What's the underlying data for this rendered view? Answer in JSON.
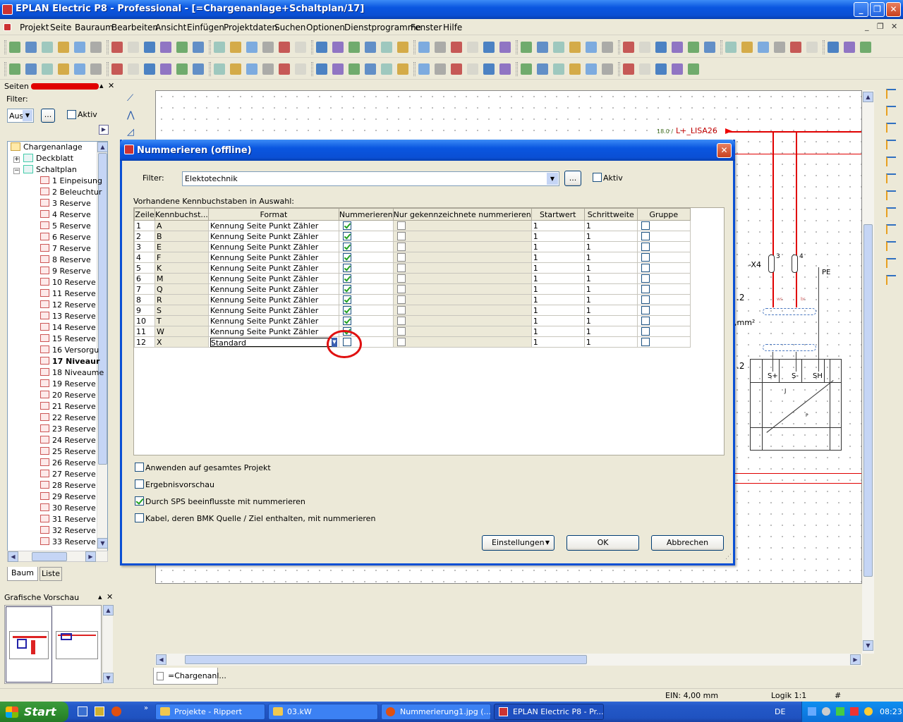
{
  "window": {
    "title": "EPLAN Electric P8 - Professional - [=Chargenanlage+Schaltplan/17]",
    "minimize": "_",
    "maximize": "❐",
    "close": "✕"
  },
  "menu": [
    "Projekt",
    "Seite",
    "Bauraum",
    "Bearbeiten",
    "Ansicht",
    "Einfügen",
    "Projektdaten",
    "Suchen",
    "Optionen",
    "Dienstprogramme",
    "Fenster",
    "Hilfe"
  ],
  "pages_panel": {
    "title": "Seiten -",
    "filter_label": "Filter:",
    "filter_value": "Aus",
    "browse_label": "...",
    "aktiv_label": "Aktiv",
    "tree_root": "Chargenanlage",
    "tree_nodes": [
      "Deckblatt",
      "Schaltplan"
    ],
    "pages": [
      "1 Einpeisung",
      "2 Beleuchtur",
      "3 Reserve",
      "4 Reserve",
      "5 Reserve",
      "6 Reserve",
      "7 Reserve",
      "8 Reserve",
      "9 Reserve",
      "10 Reserve",
      "11 Reserve",
      "12 Reserve",
      "13 Reserve",
      "14 Reserve",
      "15 Reserve",
      "16 Versorgu",
      "17 Niveaur",
      "18 Niveaume",
      "19 Reserve",
      "20 Reserve",
      "21 Reserve",
      "22 Reserve",
      "23 Reserve",
      "24 Reserve",
      "25 Reserve",
      "26 Reserve",
      "27 Reserve",
      "28 Reserve",
      "29 Reserve",
      "30 Reserve",
      "31 Reserve",
      "32 Reserve",
      "33 Reserve"
    ],
    "selected_page": "17 Niveaur",
    "tab_baum": "Baum",
    "tab_liste": "Liste"
  },
  "preview_panel": {
    "title": "Grafische Vorschau"
  },
  "document_tab": "=Chargenanl...",
  "schematic": {
    "crossref": "18.0 /",
    "signal": "L+_LISA26",
    "terminal_x4": "-X4",
    "terminal_3": "3",
    "terminal_4": "4",
    "pe": "PE",
    "ws": "ws",
    "br": "br",
    "mm2": ",mm²",
    "pos2a": ".2",
    "pos2b": ".2",
    "splus": "S+",
    "sminus": "S-",
    "sh": "SH",
    "j": "J",
    "p": "P"
  },
  "dialog": {
    "title": "Nummerieren (offline)",
    "filter_label": "Filter:",
    "filter_value": "Elektotechnik",
    "browse_label": "...",
    "aktiv_label": "Aktiv",
    "section_label": "Vorhandene Kennbuchstaben in Auswahl:",
    "columns": [
      "Zeile",
      "Kennbuchst...",
      "Format",
      "Nummerieren",
      "Nur gekennzeichnete nummerieren",
      "Startwert",
      "Schrittweite",
      "Gruppe"
    ],
    "rows": [
      {
        "zeile": "1",
        "kb": "A",
        "format": "Kennung Seite Punkt Zähler",
        "num": true,
        "start": "1",
        "step": "1"
      },
      {
        "zeile": "2",
        "kb": "B",
        "format": "Kennung Seite Punkt Zähler",
        "num": true,
        "start": "1",
        "step": "1"
      },
      {
        "zeile": "3",
        "kb": "E",
        "format": "Kennung Seite Punkt Zähler",
        "num": true,
        "start": "1",
        "step": "1"
      },
      {
        "zeile": "4",
        "kb": "F",
        "format": "Kennung Seite Punkt Zähler",
        "num": true,
        "start": "1",
        "step": "1"
      },
      {
        "zeile": "5",
        "kb": "K",
        "format": "Kennung Seite Punkt Zähler",
        "num": true,
        "start": "1",
        "step": "1"
      },
      {
        "zeile": "6",
        "kb": "M",
        "format": "Kennung Seite Punkt Zähler",
        "num": true,
        "start": "1",
        "step": "1"
      },
      {
        "zeile": "7",
        "kb": "Q",
        "format": "Kennung Seite Punkt Zähler",
        "num": true,
        "start": "1",
        "step": "1"
      },
      {
        "zeile": "8",
        "kb": "R",
        "format": "Kennung Seite Punkt Zähler",
        "num": true,
        "start": "1",
        "step": "1"
      },
      {
        "zeile": "9",
        "kb": "S",
        "format": "Kennung Seite Punkt Zähler",
        "num": true,
        "start": "1",
        "step": "1"
      },
      {
        "zeile": "10",
        "kb": "T",
        "format": "Kennung Seite Punkt Zähler",
        "num": true,
        "start": "1",
        "step": "1"
      },
      {
        "zeile": "11",
        "kb": "W",
        "format": "Kennung Seite Punkt Zähler",
        "num": true,
        "start": "1",
        "step": "1"
      },
      {
        "zeile": "12",
        "kb": "X",
        "format": "Standard",
        "num": false,
        "start": "1",
        "step": "1"
      }
    ],
    "options": [
      {
        "label": "Anwenden auf gesamtes Projekt",
        "checked": false
      },
      {
        "label": "Ergebnisvorschau",
        "checked": false
      },
      {
        "label": "Durch SPS beeinflusste mit nummerieren",
        "checked": true
      },
      {
        "label": "Kabel, deren BMK Quelle / Ziel enthalten, mit nummerieren",
        "checked": false
      }
    ],
    "settings_button": "Einstellungen",
    "ok_button": "OK",
    "cancel_button": "Abbrechen"
  },
  "statusbar": {
    "ein": "EIN: 4,00 mm",
    "logik": "Logik 1:1",
    "hash": "#"
  },
  "taskbar": {
    "start": "Start",
    "tasks": [
      "Projekte - Rippert",
      "03.kW",
      "Nummerierung1.jpg (...",
      "EPLAN Electric P8 - Pr..."
    ],
    "lang": "DE",
    "clock": "08:23"
  }
}
